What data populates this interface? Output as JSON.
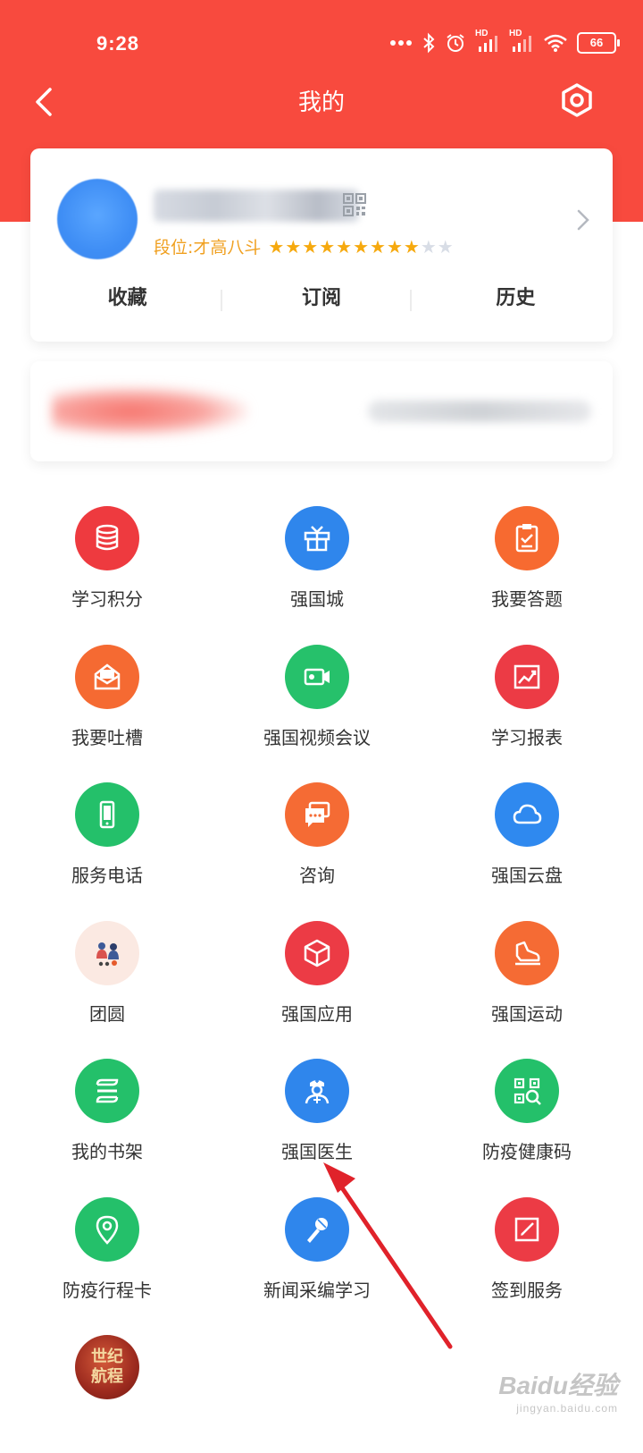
{
  "status_bar": {
    "time": "9:28",
    "battery": "66",
    "net_hd_1": "HD",
    "net_hd_2": "HD"
  },
  "nav": {
    "title": "我的"
  },
  "profile": {
    "rank_label": "段位:才高八斗",
    "stars_total": 11,
    "stars_filled": 9,
    "tabs": [
      {
        "label": "收藏"
      },
      {
        "label": "订阅"
      },
      {
        "label": "历史"
      }
    ]
  },
  "grid": {
    "items": [
      {
        "label": "学习积分",
        "icon": "database-icon",
        "color": "#ee3a3f"
      },
      {
        "label": "强国城",
        "icon": "gift-box-icon",
        "color": "#2f86ec"
      },
      {
        "label": "我要答题",
        "icon": "clipboard-check-icon",
        "color": "#f76a30"
      },
      {
        "label": "我要吐槽",
        "icon": "mail-open-icon",
        "color": "#f56a32"
      },
      {
        "label": "强国视频会议",
        "icon": "video-camera-icon",
        "color": "#26c16b"
      },
      {
        "label": "学习报表",
        "icon": "chart-trend-icon",
        "color": "#ec3b45"
      },
      {
        "label": "服务电话",
        "icon": "phone-icon",
        "color": "#24c06a"
      },
      {
        "label": "咨询",
        "icon": "chat-bubble-icon",
        "color": "#f56b34"
      },
      {
        "label": "强国云盘",
        "icon": "cloud-icon",
        "color": "#2f89ef"
      },
      {
        "label": "团圆",
        "icon": "reunion-illustration-icon",
        "color": "#fbe9e2"
      },
      {
        "label": "强国应用",
        "icon": "cube-icon",
        "color": "#ec3b45"
      },
      {
        "label": "强国运动",
        "icon": "sneaker-icon",
        "color": "#f56b34"
      },
      {
        "label": "我的书架",
        "icon": "bookshelf-icon",
        "color": "#24c06a"
      },
      {
        "label": "强国医生",
        "icon": "doctor-icon",
        "color": "#2f86ec"
      },
      {
        "label": "防疫健康码",
        "icon": "qr-scan-icon",
        "color": "#24c06a"
      },
      {
        "label": "防疫行程卡",
        "icon": "location-pin-icon",
        "color": "#24c06a"
      },
      {
        "label": "新闻采编学习",
        "icon": "microphone-icon",
        "color": "#2f86ec"
      },
      {
        "label": "签到服务",
        "icon": "sign-in-icon",
        "color": "#ec3b45"
      },
      {
        "label": "",
        "icon": "century-voyage-badge-icon",
        "color": "#9c2a1e",
        "badge_text_1": "世纪",
        "badge_text_2": "航程"
      }
    ]
  },
  "watermark": {
    "main": "Baidu经验",
    "sub": "jingyan.baidu.com"
  }
}
